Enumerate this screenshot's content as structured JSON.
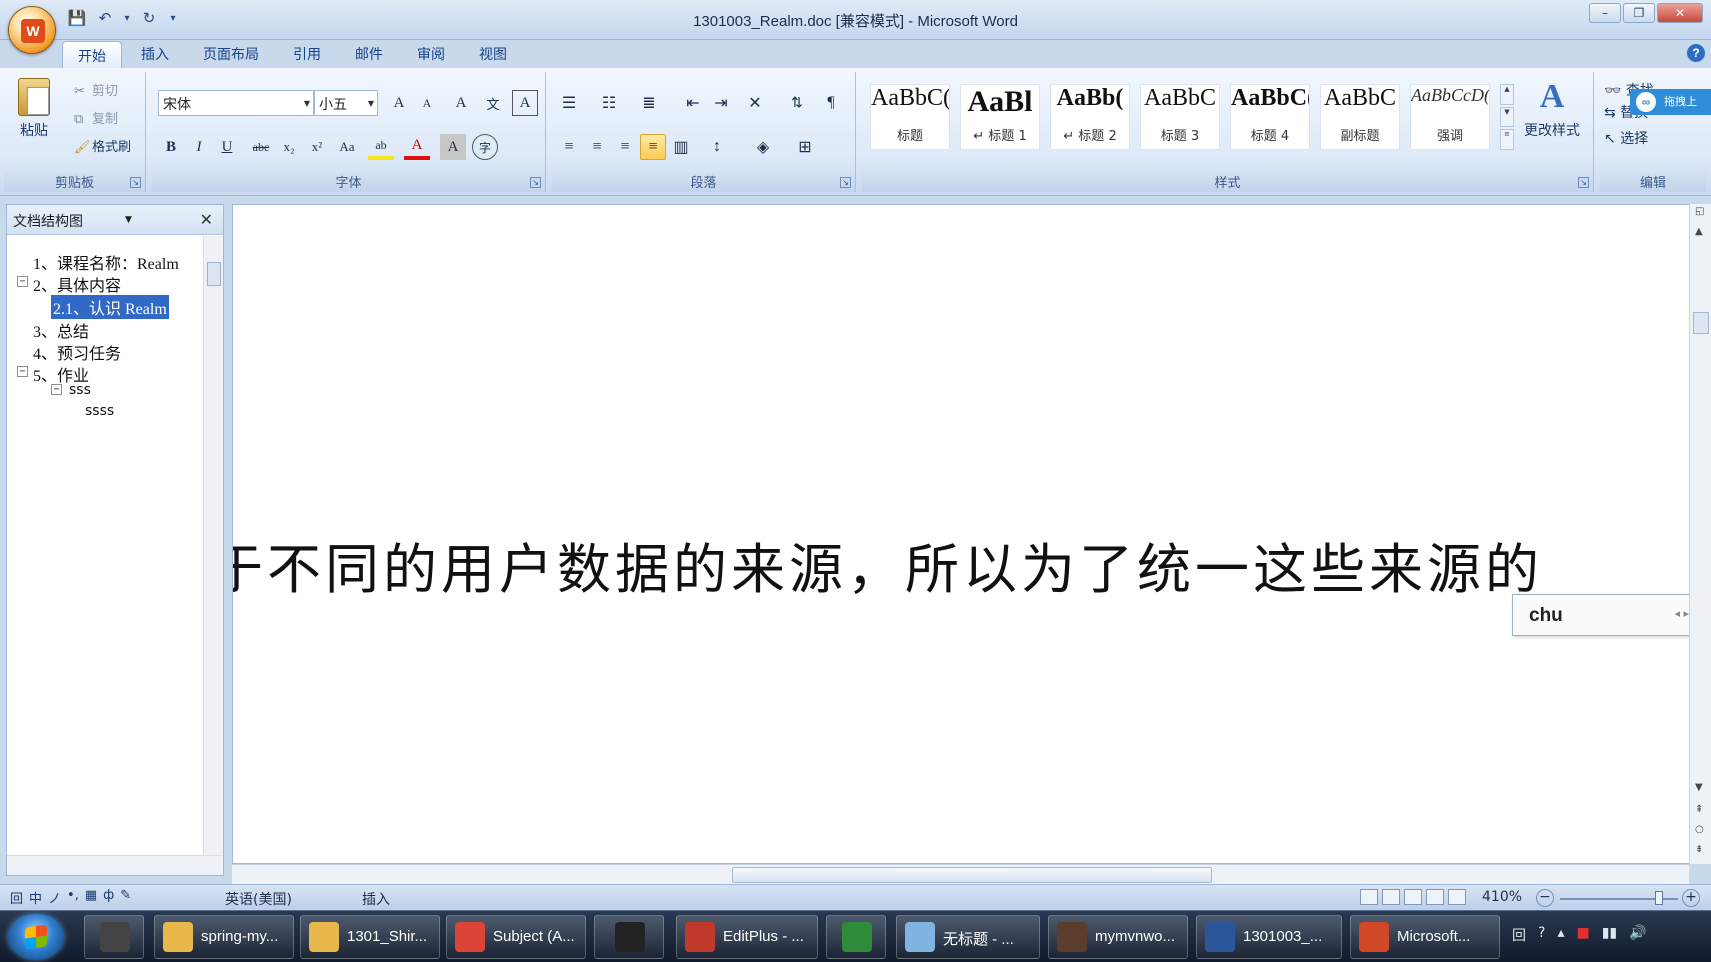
{
  "window": {
    "title": "1301003_Realm.doc [兼容模式] - Microsoft Word",
    "minimize": "–",
    "maximize": "❐",
    "close": "✕"
  },
  "qat": {
    "save": "💾",
    "undo": "↶",
    "undo_dd": "▾",
    "redo": "↻",
    "customize": "▾"
  },
  "tabs": [
    "开始",
    "插入",
    "页面布局",
    "引用",
    "邮件",
    "审阅",
    "视图"
  ],
  "help": "?",
  "ribbon": {
    "clipboard": {
      "label": "剪贴板",
      "paste": "粘贴",
      "cut": "剪切",
      "copy": "复制",
      "format_painter": "格式刷"
    },
    "font": {
      "label": "字体",
      "font_name": "宋体",
      "font_size": "小五",
      "grow": "A",
      "shrink": "A",
      "clear": "A",
      "phonetic": "文",
      "border_char": "A",
      "bold": "B",
      "italic": "I",
      "underline": "U",
      "strike": "abc",
      "subscript": "x₂",
      "superscript": "x²",
      "case": "Aa",
      "highlight": "ab",
      "font_color": "A",
      "shading": "A",
      "enclose": "字"
    },
    "paragraph": {
      "label": "段落"
    },
    "styles": {
      "label": "样式",
      "items": [
        {
          "sample": "AaBbC(",
          "name": "标题"
        },
        {
          "sample": "AaBl",
          "name": "↵ 标题 1"
        },
        {
          "sample": "AaBb(",
          "name": "↵ 标题 2"
        },
        {
          "sample": "AaBbC",
          "name": "标题 3"
        },
        {
          "sample": "AaBbC(",
          "name": "标题 4"
        },
        {
          "sample": "AaBbC",
          "name": "副标题"
        },
        {
          "sample": "AaBbCcD(",
          "name": "强调"
        }
      ],
      "change_styles": "更改样式",
      "change_styles_icon": "A"
    },
    "editing": {
      "label": "编辑",
      "find": "查找",
      "replace": "替换",
      "select": "选择"
    }
  },
  "baidu_float": {
    "icon": "∞",
    "text": "拖拽上"
  },
  "nav_pane": {
    "title": "文档结构图",
    "close": "✕",
    "items": [
      {
        "text": "1、课程名称：Realm",
        "expander": ""
      },
      {
        "text": "2、具体内容",
        "expander": "⊟"
      },
      {
        "text": "2.1、认识 Realm",
        "expander": ""
      },
      {
        "text": "3、总结",
        "expander": ""
      },
      {
        "text": "4、预习任务",
        "expander": ""
      },
      {
        "text": "5、作业",
        "expander": "⊟"
      },
      {
        "text": "sss",
        "expander": "⊟"
      },
      {
        "text": "ssss",
        "expander": ""
      }
    ]
  },
  "document": {
    "text": "于不同的用户数据的来源，所以为了统一这些来源的"
  },
  "ime": {
    "composition": "chu",
    "arrows": "◂ ▸"
  },
  "status": {
    "ime_icons": [
      "回",
      "中",
      "ノ",
      "•,",
      "▦",
      "ф",
      "✎"
    ],
    "language": "英语(美国)",
    "mode": "插入",
    "zoom": "410%",
    "zoom_minus": "−",
    "zoom_plus": "+"
  },
  "taskbar": {
    "items": [
      {
        "label": "",
        "color": "#444444"
      },
      {
        "label": "spring-my...",
        "color": "#e8b84a"
      },
      {
        "label": "1301_Shir...",
        "color": "#e8b84a"
      },
      {
        "label": "Subject (A...",
        "color": "#db4437"
      },
      {
        "label": "",
        "color": "#222222"
      },
      {
        "label": "EditPlus - ...",
        "color": "#c0392b"
      },
      {
        "label": "",
        "color": "#2e8b3a"
      },
      {
        "label": "无标题 - ...",
        "color": "#7fb4e0"
      },
      {
        "label": "mymvnwo...",
        "color": "#5a3e2b"
      },
      {
        "label": "1301003_...",
        "color": "#2b579a"
      },
      {
        "label": "Microsoft...",
        "color": "#d24726"
      }
    ],
    "tray": [
      "回",
      "?",
      "▴",
      "■",
      "▮▮",
      "🔊"
    ]
  }
}
